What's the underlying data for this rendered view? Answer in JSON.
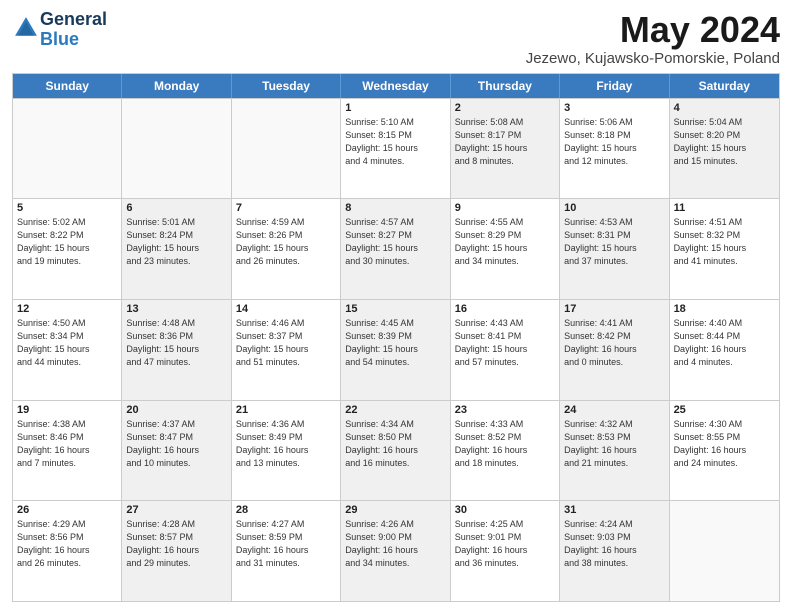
{
  "header": {
    "logo_general": "General",
    "logo_blue": "Blue",
    "title": "May 2024",
    "location": "Jezewo, Kujawsko-Pomorskie, Poland"
  },
  "days_of_week": [
    "Sunday",
    "Monday",
    "Tuesday",
    "Wednesday",
    "Thursday",
    "Friday",
    "Saturday"
  ],
  "weeks": [
    [
      {
        "num": "",
        "info": "",
        "shaded": false,
        "empty": true
      },
      {
        "num": "",
        "info": "",
        "shaded": false,
        "empty": true
      },
      {
        "num": "",
        "info": "",
        "shaded": false,
        "empty": true
      },
      {
        "num": "1",
        "info": "Sunrise: 5:10 AM\nSunset: 8:15 PM\nDaylight: 15 hours\nand 4 minutes.",
        "shaded": false,
        "empty": false
      },
      {
        "num": "2",
        "info": "Sunrise: 5:08 AM\nSunset: 8:17 PM\nDaylight: 15 hours\nand 8 minutes.",
        "shaded": true,
        "empty": false
      },
      {
        "num": "3",
        "info": "Sunrise: 5:06 AM\nSunset: 8:18 PM\nDaylight: 15 hours\nand 12 minutes.",
        "shaded": false,
        "empty": false
      },
      {
        "num": "4",
        "info": "Sunrise: 5:04 AM\nSunset: 8:20 PM\nDaylight: 15 hours\nand 15 minutes.",
        "shaded": true,
        "empty": false
      }
    ],
    [
      {
        "num": "5",
        "info": "Sunrise: 5:02 AM\nSunset: 8:22 PM\nDaylight: 15 hours\nand 19 minutes.",
        "shaded": false,
        "empty": false
      },
      {
        "num": "6",
        "info": "Sunrise: 5:01 AM\nSunset: 8:24 PM\nDaylight: 15 hours\nand 23 minutes.",
        "shaded": true,
        "empty": false
      },
      {
        "num": "7",
        "info": "Sunrise: 4:59 AM\nSunset: 8:26 PM\nDaylight: 15 hours\nand 26 minutes.",
        "shaded": false,
        "empty": false
      },
      {
        "num": "8",
        "info": "Sunrise: 4:57 AM\nSunset: 8:27 PM\nDaylight: 15 hours\nand 30 minutes.",
        "shaded": true,
        "empty": false
      },
      {
        "num": "9",
        "info": "Sunrise: 4:55 AM\nSunset: 8:29 PM\nDaylight: 15 hours\nand 34 minutes.",
        "shaded": false,
        "empty": false
      },
      {
        "num": "10",
        "info": "Sunrise: 4:53 AM\nSunset: 8:31 PM\nDaylight: 15 hours\nand 37 minutes.",
        "shaded": true,
        "empty": false
      },
      {
        "num": "11",
        "info": "Sunrise: 4:51 AM\nSunset: 8:32 PM\nDaylight: 15 hours\nand 41 minutes.",
        "shaded": false,
        "empty": false
      }
    ],
    [
      {
        "num": "12",
        "info": "Sunrise: 4:50 AM\nSunset: 8:34 PM\nDaylight: 15 hours\nand 44 minutes.",
        "shaded": false,
        "empty": false
      },
      {
        "num": "13",
        "info": "Sunrise: 4:48 AM\nSunset: 8:36 PM\nDaylight: 15 hours\nand 47 minutes.",
        "shaded": true,
        "empty": false
      },
      {
        "num": "14",
        "info": "Sunrise: 4:46 AM\nSunset: 8:37 PM\nDaylight: 15 hours\nand 51 minutes.",
        "shaded": false,
        "empty": false
      },
      {
        "num": "15",
        "info": "Sunrise: 4:45 AM\nSunset: 8:39 PM\nDaylight: 15 hours\nand 54 minutes.",
        "shaded": true,
        "empty": false
      },
      {
        "num": "16",
        "info": "Sunrise: 4:43 AM\nSunset: 8:41 PM\nDaylight: 15 hours\nand 57 minutes.",
        "shaded": false,
        "empty": false
      },
      {
        "num": "17",
        "info": "Sunrise: 4:41 AM\nSunset: 8:42 PM\nDaylight: 16 hours\nand 0 minutes.",
        "shaded": true,
        "empty": false
      },
      {
        "num": "18",
        "info": "Sunrise: 4:40 AM\nSunset: 8:44 PM\nDaylight: 16 hours\nand 4 minutes.",
        "shaded": false,
        "empty": false
      }
    ],
    [
      {
        "num": "19",
        "info": "Sunrise: 4:38 AM\nSunset: 8:46 PM\nDaylight: 16 hours\nand 7 minutes.",
        "shaded": false,
        "empty": false
      },
      {
        "num": "20",
        "info": "Sunrise: 4:37 AM\nSunset: 8:47 PM\nDaylight: 16 hours\nand 10 minutes.",
        "shaded": true,
        "empty": false
      },
      {
        "num": "21",
        "info": "Sunrise: 4:36 AM\nSunset: 8:49 PM\nDaylight: 16 hours\nand 13 minutes.",
        "shaded": false,
        "empty": false
      },
      {
        "num": "22",
        "info": "Sunrise: 4:34 AM\nSunset: 8:50 PM\nDaylight: 16 hours\nand 16 minutes.",
        "shaded": true,
        "empty": false
      },
      {
        "num": "23",
        "info": "Sunrise: 4:33 AM\nSunset: 8:52 PM\nDaylight: 16 hours\nand 18 minutes.",
        "shaded": false,
        "empty": false
      },
      {
        "num": "24",
        "info": "Sunrise: 4:32 AM\nSunset: 8:53 PM\nDaylight: 16 hours\nand 21 minutes.",
        "shaded": true,
        "empty": false
      },
      {
        "num": "25",
        "info": "Sunrise: 4:30 AM\nSunset: 8:55 PM\nDaylight: 16 hours\nand 24 minutes.",
        "shaded": false,
        "empty": false
      }
    ],
    [
      {
        "num": "26",
        "info": "Sunrise: 4:29 AM\nSunset: 8:56 PM\nDaylight: 16 hours\nand 26 minutes.",
        "shaded": false,
        "empty": false
      },
      {
        "num": "27",
        "info": "Sunrise: 4:28 AM\nSunset: 8:57 PM\nDaylight: 16 hours\nand 29 minutes.",
        "shaded": true,
        "empty": false
      },
      {
        "num": "28",
        "info": "Sunrise: 4:27 AM\nSunset: 8:59 PM\nDaylight: 16 hours\nand 31 minutes.",
        "shaded": false,
        "empty": false
      },
      {
        "num": "29",
        "info": "Sunrise: 4:26 AM\nSunset: 9:00 PM\nDaylight: 16 hours\nand 34 minutes.",
        "shaded": true,
        "empty": false
      },
      {
        "num": "30",
        "info": "Sunrise: 4:25 AM\nSunset: 9:01 PM\nDaylight: 16 hours\nand 36 minutes.",
        "shaded": false,
        "empty": false
      },
      {
        "num": "31",
        "info": "Sunrise: 4:24 AM\nSunset: 9:03 PM\nDaylight: 16 hours\nand 38 minutes.",
        "shaded": true,
        "empty": false
      },
      {
        "num": "",
        "info": "",
        "shaded": false,
        "empty": true
      }
    ]
  ]
}
